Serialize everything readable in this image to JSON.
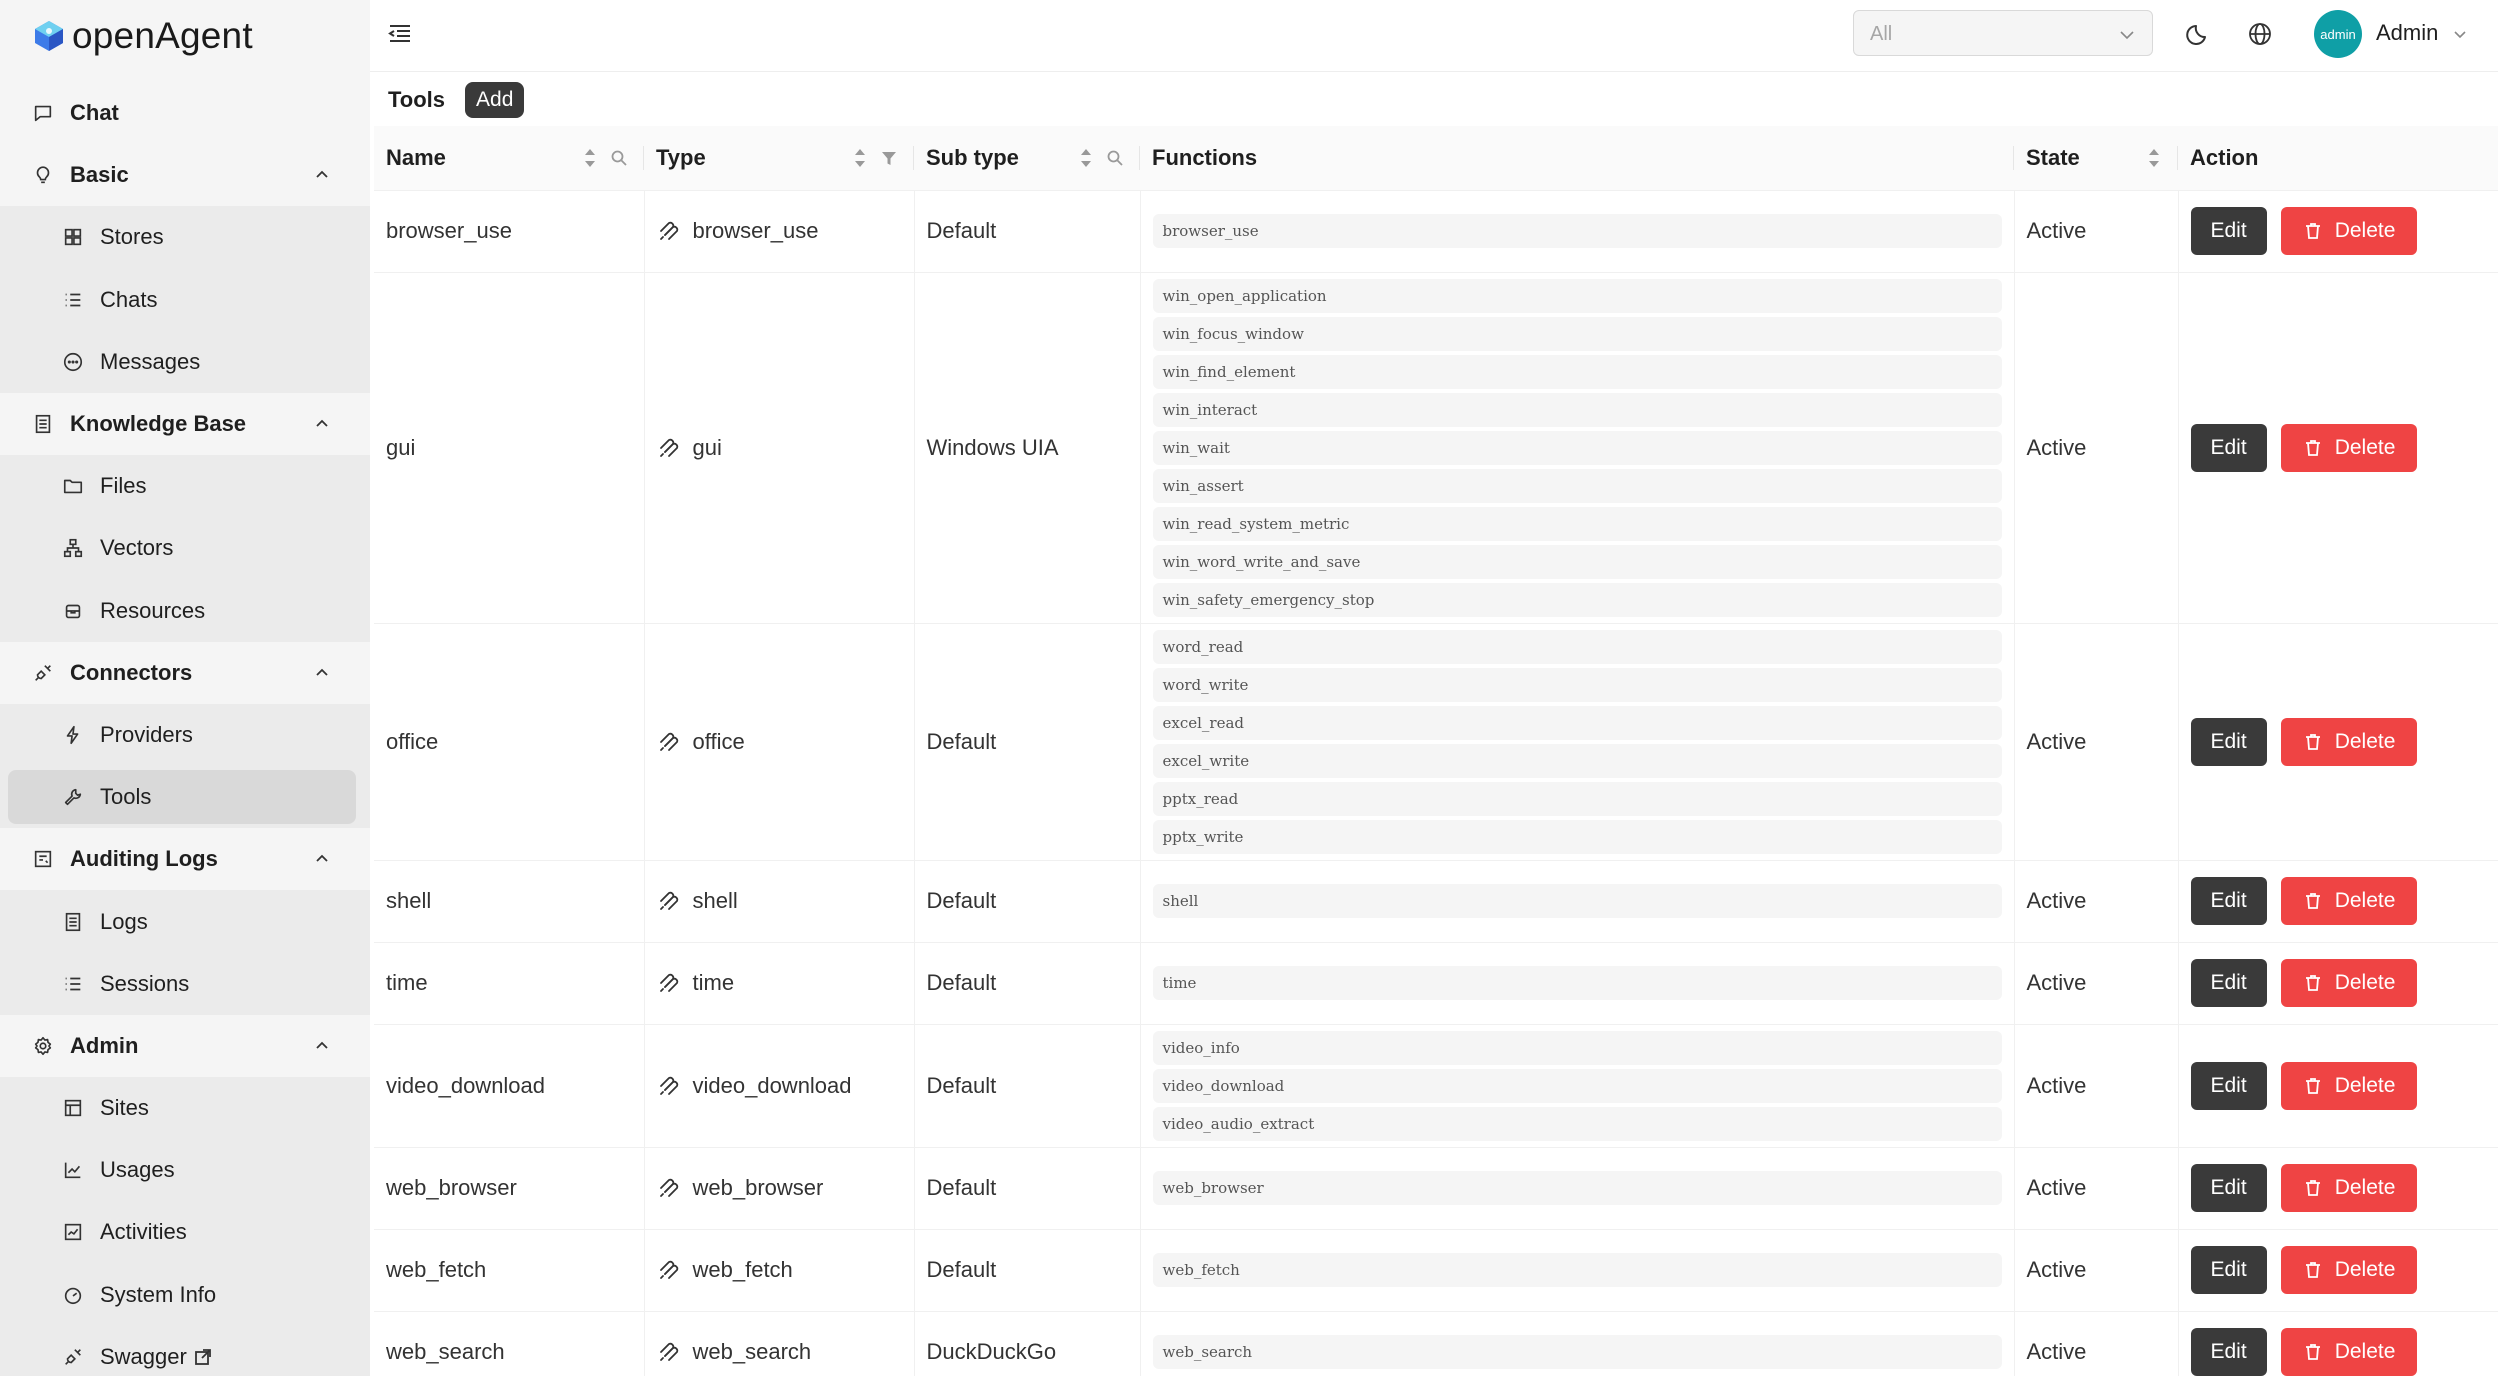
{
  "app": {
    "name": "openAgent",
    "colors": {
      "accent": "#3a3a3a",
      "danger": "#ef4444",
      "avatar": "#0f9fa6",
      "sidebar_bg": "#f5f5f5",
      "sidebar_active": "#d9d9d9"
    }
  },
  "sidebar": {
    "chat": {
      "label": "Chat",
      "icon": "chat-bubble-icon"
    },
    "basic": {
      "label": "Basic",
      "icon": "lightbulb-icon",
      "children": [
        {
          "label": "Stores",
          "icon": "grid-icon"
        },
        {
          "label": "Chats",
          "icon": "list-icon"
        },
        {
          "label": "Messages",
          "icon": "message-dots-icon"
        }
      ]
    },
    "knowledge": {
      "label": "Knowledge Base",
      "icon": "book-icon",
      "children": [
        {
          "label": "Files",
          "icon": "folder-icon"
        },
        {
          "label": "Vectors",
          "icon": "hierarchy-icon"
        },
        {
          "label": "Resources",
          "icon": "box-icon"
        }
      ]
    },
    "connectors": {
      "label": "Connectors",
      "icon": "plug-icon",
      "children": [
        {
          "label": "Providers",
          "icon": "bolt-icon"
        },
        {
          "label": "Tools",
          "icon": "wrench-icon",
          "active": true
        }
      ]
    },
    "auditing": {
      "label": "Auditing Logs",
      "icon": "log-icon",
      "children": [
        {
          "label": "Logs",
          "icon": "document-icon"
        },
        {
          "label": "Sessions",
          "icon": "list-icon"
        }
      ]
    },
    "admin": {
      "label": "Admin",
      "icon": "gear-icon",
      "children": [
        {
          "label": "Sites",
          "icon": "layout-icon"
        },
        {
          "label": "Usages",
          "icon": "line-chart-icon"
        },
        {
          "label": "Activities",
          "icon": "activity-chart-icon"
        },
        {
          "label": "System Info",
          "icon": "dashboard-icon"
        },
        {
          "label": "Swagger",
          "icon": "link-icon"
        }
      ]
    }
  },
  "header": {
    "site_select": {
      "value": "All"
    },
    "user": {
      "avatar_text": "admin",
      "name": "Admin"
    }
  },
  "page": {
    "title": "Tools",
    "add_label": "Add"
  },
  "table": {
    "columns": {
      "name": "Name",
      "type": "Type",
      "subtype": "Sub type",
      "functions": "Functions",
      "state": "State",
      "action": "Action"
    },
    "edit_label": "Edit",
    "delete_label": "Delete",
    "rows": [
      {
        "name": "browser_use",
        "type": "browser_use",
        "subtype": "Default",
        "functions": [
          "browser_use"
        ],
        "state": "Active"
      },
      {
        "name": "gui",
        "type": "gui",
        "subtype": "Windows UIA",
        "functions": [
          "win_open_application",
          "win_focus_window",
          "win_find_element",
          "win_interact",
          "win_wait",
          "win_assert",
          "win_read_system_metric",
          "win_word_write_and_save",
          "win_safety_emergency_stop"
        ],
        "state": "Active"
      },
      {
        "name": "office",
        "type": "office",
        "subtype": "Default",
        "functions": [
          "word_read",
          "word_write",
          "excel_read",
          "excel_write",
          "pptx_read",
          "pptx_write"
        ],
        "state": "Active"
      },
      {
        "name": "shell",
        "type": "shell",
        "subtype": "Default",
        "functions": [
          "shell"
        ],
        "state": "Active"
      },
      {
        "name": "time",
        "type": "time",
        "subtype": "Default",
        "functions": [
          "time"
        ],
        "state": "Active"
      },
      {
        "name": "video_download",
        "type": "video_download",
        "subtype": "Default",
        "functions": [
          "video_info",
          "video_download",
          "video_audio_extract"
        ],
        "state": "Active"
      },
      {
        "name": "web_browser",
        "type": "web_browser",
        "subtype": "Default",
        "functions": [
          "web_browser"
        ],
        "state": "Active"
      },
      {
        "name": "web_fetch",
        "type": "web_fetch",
        "subtype": "Default",
        "functions": [
          "web_fetch"
        ],
        "state": "Active"
      },
      {
        "name": "web_search",
        "type": "web_search",
        "subtype": "DuckDuckGo",
        "functions": [
          "web_search"
        ],
        "state": "Active"
      }
    ]
  }
}
